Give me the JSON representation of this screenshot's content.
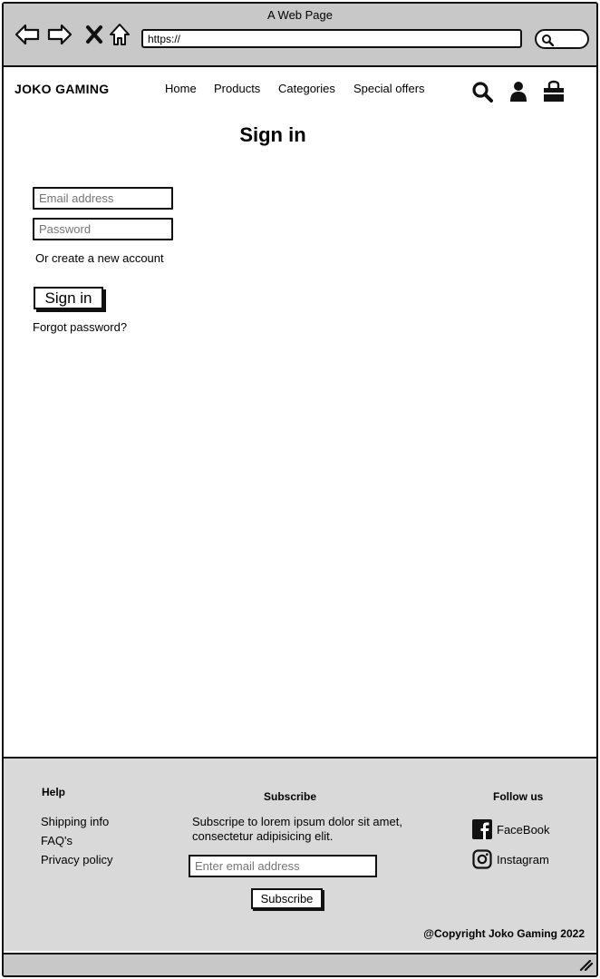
{
  "browser": {
    "window_title": "A Web Page",
    "url": "https://"
  },
  "site": {
    "logo": "JOKO GAMING",
    "nav": [
      {
        "label": "Home"
      },
      {
        "label": "Products"
      },
      {
        "label": "Categories"
      },
      {
        "label": "Special offers"
      }
    ],
    "icons": [
      "search-icon",
      "user-icon",
      "shopping-bag-icon"
    ]
  },
  "signin": {
    "title": "Sign in",
    "email_placeholder": "Email address",
    "password_placeholder": "Password",
    "create_account": "Or create a new account",
    "button": "Sign in",
    "forgot": "Forgot password?"
  },
  "footer": {
    "help_heading": "Help",
    "help_links": [
      "Shipping info",
      "FAQ's",
      "Privacy policy"
    ],
    "subscribe_heading": "Subscribe",
    "subscribe_text": "Subscripe to lorem ipsum dolor sit amet, consectetur adipisicing elit.",
    "email_placeholder": "Enter email address",
    "subscribe_button": "Subscribe",
    "follow_heading": "Follow us",
    "social": [
      {
        "label": "FaceBook",
        "icon": "facebook-icon"
      },
      {
        "label": "Instagram",
        "icon": "instagram-icon"
      }
    ],
    "copyright": "@Copyright Joko Gaming 2022"
  },
  "colors": {
    "chrome": "#c8c8c8",
    "footer": "#d9d9d9",
    "ink": "#111111"
  }
}
